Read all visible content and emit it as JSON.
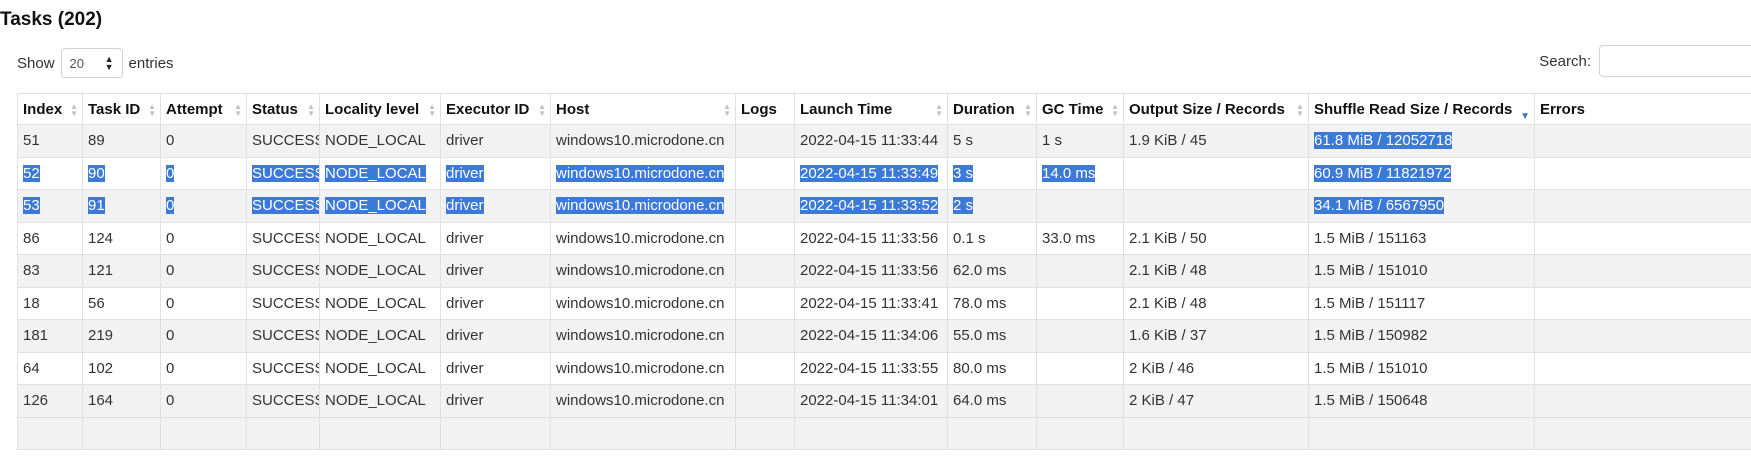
{
  "title": "Tasks (202)",
  "show": {
    "label": "Show",
    "value": "20",
    "suffix": "entries"
  },
  "search": {
    "label": "Search:",
    "value": ""
  },
  "columns": [
    "Index",
    "Task ID",
    "Attempt",
    "Status",
    "Locality level",
    "Executor ID",
    "Host",
    "Logs",
    "Launch Time",
    "Duration",
    "GC Time",
    "Output Size / Records",
    "Shuffle Read Size / Records",
    "Errors"
  ],
  "rows": [
    {
      "cells": [
        "51",
        "89",
        "0",
        "SUCCESS",
        "NODE_LOCAL",
        "driver",
        "windows10.microdone.cn",
        "",
        "2022-04-15 11:33:44",
        "5 s",
        "1 s",
        "1.9 KiB / 45",
        "61.8 MiB / 12052718",
        ""
      ],
      "selected": false
    },
    {
      "cells": [
        "52",
        "90",
        "0",
        "SUCCESS",
        "NODE_LOCAL",
        "driver",
        "windows10.microdone.cn",
        "",
        "2022-04-15 11:33:49",
        "3 s",
        "14.0 ms",
        "",
        "60.9 MiB / 11821972",
        ""
      ],
      "selected": true
    },
    {
      "cells": [
        "53",
        "91",
        "0",
        "SUCCESS",
        "NODE_LOCAL",
        "driver",
        "windows10.microdone.cn",
        "",
        "2022-04-15 11:33:52",
        "2 s",
        "",
        "",
        "34.1 MiB / 6567950",
        ""
      ],
      "selected": true
    },
    {
      "cells": [
        "86",
        "124",
        "0",
        "SUCCESS",
        "NODE_LOCAL",
        "driver",
        "windows10.microdone.cn",
        "",
        "2022-04-15 11:33:56",
        "0.1 s",
        "33.0 ms",
        "2.1 KiB / 50",
        "1.5 MiB / 151163",
        ""
      ],
      "selected": false
    },
    {
      "cells": [
        "83",
        "121",
        "0",
        "SUCCESS",
        "NODE_LOCAL",
        "driver",
        "windows10.microdone.cn",
        "",
        "2022-04-15 11:33:56",
        "62.0 ms",
        "",
        "2.1 KiB / 48",
        "1.5 MiB / 151010",
        ""
      ],
      "selected": false
    },
    {
      "cells": [
        "18",
        "56",
        "0",
        "SUCCESS",
        "NODE_LOCAL",
        "driver",
        "windows10.microdone.cn",
        "",
        "2022-04-15 11:33:41",
        "78.0 ms",
        "",
        "2.1 KiB / 48",
        "1.5 MiB / 151117",
        ""
      ],
      "selected": false
    },
    {
      "cells": [
        "181",
        "219",
        "0",
        "SUCCESS",
        "NODE_LOCAL",
        "driver",
        "windows10.microdone.cn",
        "",
        "2022-04-15 11:34:06",
        "55.0 ms",
        "",
        "1.6 KiB / 37",
        "1.5 MiB / 150982",
        ""
      ],
      "selected": false
    },
    {
      "cells": [
        "64",
        "102",
        "0",
        "SUCCESS",
        "NODE_LOCAL",
        "driver",
        "windows10.microdone.cn",
        "",
        "2022-04-15 11:33:55",
        "80.0 ms",
        "",
        "2 KiB / 46",
        "1.5 MiB / 151010",
        ""
      ],
      "selected": false
    },
    {
      "cells": [
        "126",
        "164",
        "0",
        "SUCCESS",
        "NODE_LOCAL",
        "driver",
        "windows10.microdone.cn",
        "",
        "2022-04-15 11:34:01",
        "64.0 ms",
        "",
        "2 KiB / 47",
        "1.5 MiB / 150648",
        ""
      ],
      "selected": false
    }
  ],
  "sort": {
    "column_index": 12,
    "direction": "desc"
  },
  "colors": {
    "selection": "#3b7ad6",
    "stripe": "#f2f2f2",
    "border": "#dee2e6",
    "sort_active": "#4a6fc2"
  }
}
